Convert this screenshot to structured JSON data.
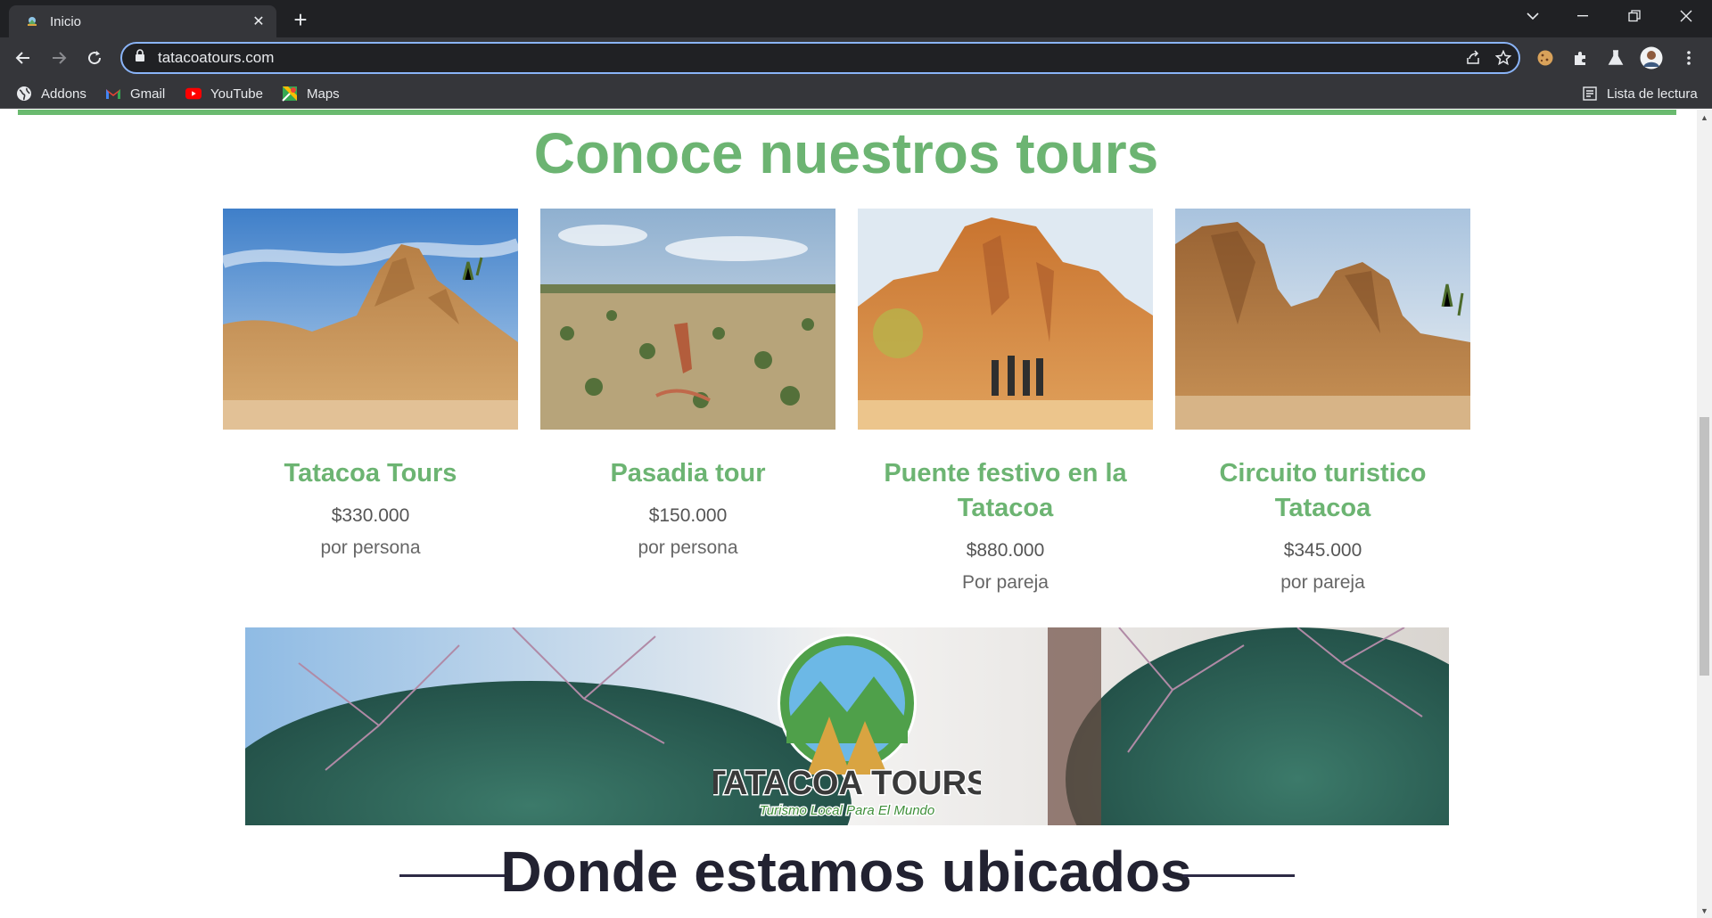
{
  "browser": {
    "tab_title": "Inicio",
    "new_tab": "+",
    "url": "tatacoatours.com",
    "bookmarks": [
      {
        "label": "Addons",
        "icon": "globe-icon"
      },
      {
        "label": "Gmail",
        "icon": "gmail-icon"
      },
      {
        "label": "YouTube",
        "icon": "youtube-icon"
      },
      {
        "label": "Maps",
        "icon": "maps-icon"
      }
    ],
    "reading_list": "Lista de lectura"
  },
  "page": {
    "tours_heading": "Conoce nuestros tours",
    "tours": [
      {
        "title": "Tatacoa Tours",
        "price": "$330.000",
        "unit": "por persona",
        "photo": "desert-rock-formation-photo"
      },
      {
        "title": "Pasadia tour",
        "price": "$150.000",
        "unit": "por persona",
        "photo": "desert-landscape-photo"
      },
      {
        "title": "Puente festivo en la Tatacoa",
        "price": "$880.000",
        "unit": "Por pareja",
        "photo": "tourists-at-rock-formation-photo"
      },
      {
        "title": "Circuito turistico Tatacoa",
        "price": "$345.000",
        "unit": "por pareja",
        "photo": "eroded-cliffs-photo"
      }
    ],
    "banner": {
      "logo_name": "TATACOA TOURS",
      "logo_tagline": "Turismo Local Para El Mundo"
    },
    "location_heading": "Donde estamos ubicados"
  },
  "colors": {
    "accent_green": "#6cb472",
    "dark_heading": "#222231",
    "chrome_dark": "#202124",
    "chrome_toolbar": "#35363a",
    "omnibox_focus": "#8ab4f8"
  }
}
